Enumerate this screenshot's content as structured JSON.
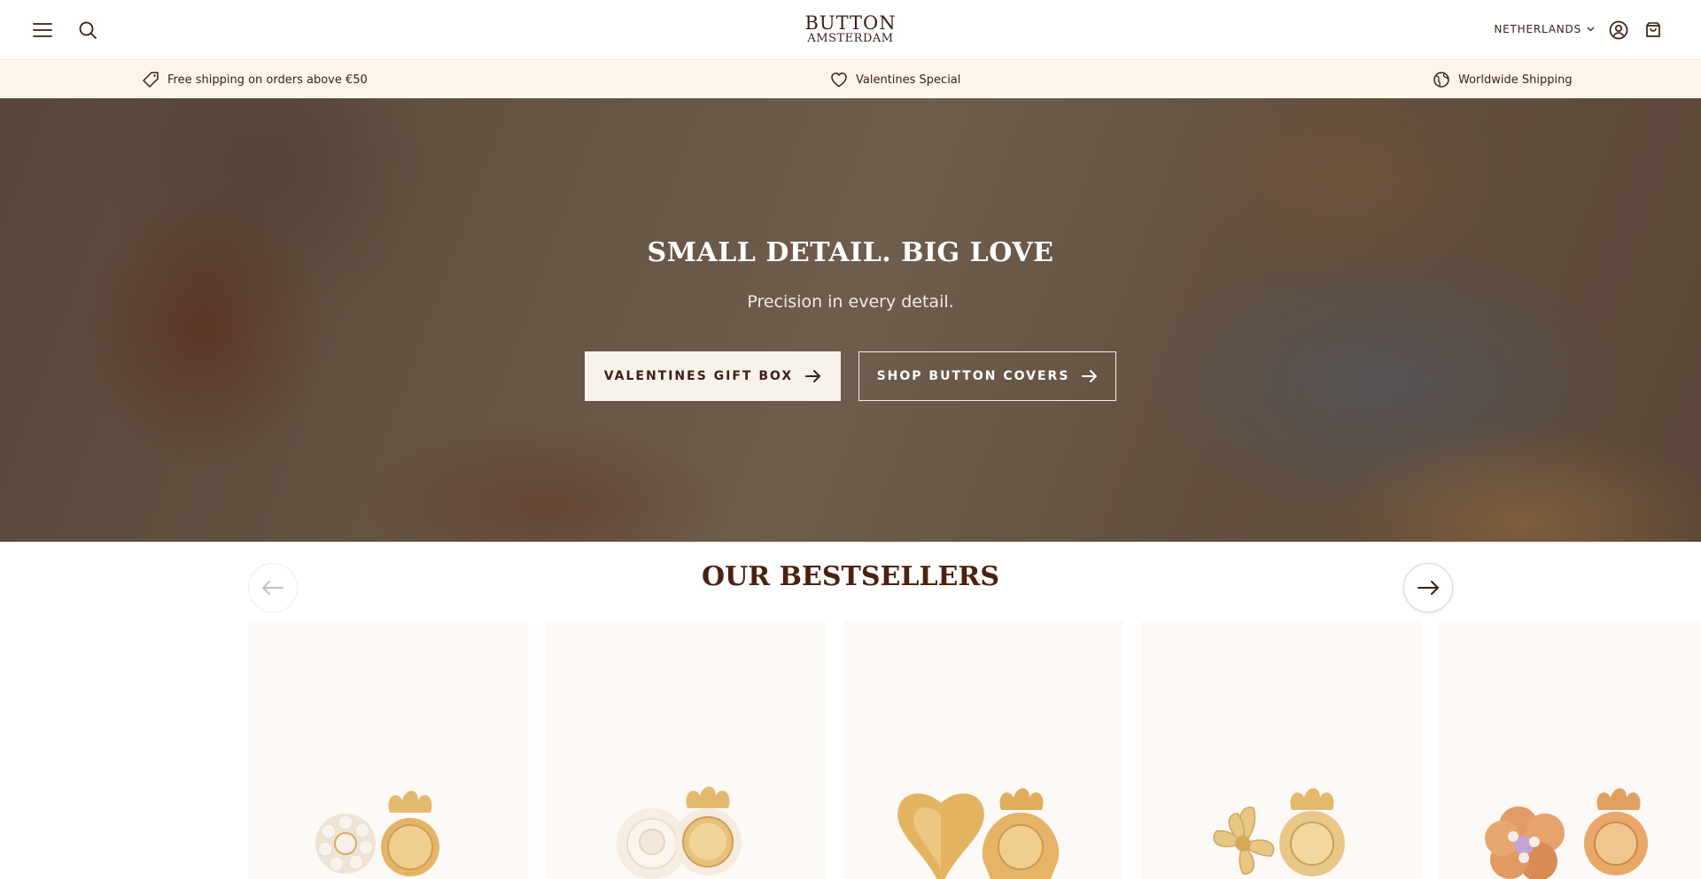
{
  "header": {
    "logo_line1": "BUTTON",
    "logo_line2": "AMSTERDAM",
    "country": "NETHERLANDS"
  },
  "announcement": [
    {
      "text": "Free shipping on orders above €50",
      "icon": "tag-icon"
    },
    {
      "text": "Valentines Special",
      "icon": "heart-icon"
    },
    {
      "text": "Worldwide Shipping",
      "icon": "globe-icon"
    }
  ],
  "hero": {
    "title": "SMALL DETAIL. BIG LOVE",
    "subtitle": "Precision in every detail.",
    "cta_primary": "VALENTINES GIFT BOX",
    "cta_secondary": "SHOP BUTTON COVERS"
  },
  "bestsellers": {
    "title": "OUR BESTSELLERS",
    "products": [
      {
        "icon": "pearl-cluster-button-cover-icon"
      },
      {
        "icon": "white-rose-button-cover-icon"
      },
      {
        "icon": "gold-heart-button-cover-icon"
      },
      {
        "icon": "gold-flower-button-cover-icon"
      },
      {
        "icon": "copper-pearl-flower-button-cover-icon"
      }
    ]
  },
  "colors": {
    "brand_brown": "#3b1f12",
    "announcement_bg": "#fcf5ea",
    "gold": "#d9ac5c",
    "card_bg": "#fcf9f6"
  }
}
